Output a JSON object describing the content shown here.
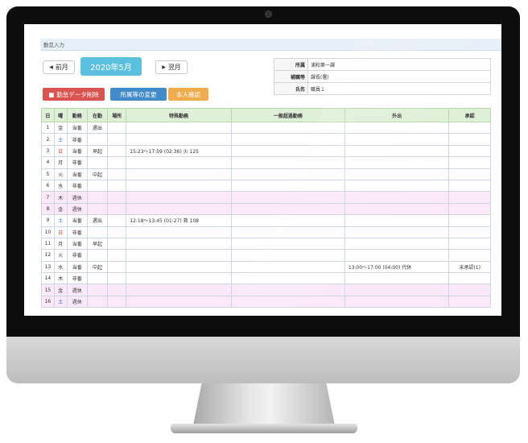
{
  "breadcrumb": "勤怠入力",
  "nav": {
    "prev_label": "前月",
    "month_label": "2020年5月",
    "next_label": "翌月"
  },
  "info": [
    {
      "key": "所属",
      "value": "浦和第一課"
    },
    {
      "key": "補職等",
      "value": "課長(署)"
    },
    {
      "key": "氏名",
      "value": "職員１"
    }
  ],
  "actions": {
    "delete_label": "勤怠データ削除",
    "change_label": "所属等の変更",
    "confirm_label": "本人確認"
  },
  "table": {
    "headers": [
      "日",
      "曜",
      "勤務",
      "在勤",
      "場所",
      "特殊勤務",
      "一般超過勤務",
      "外出",
      "承認"
    ],
    "rows": [
      {
        "day": "1",
        "dow": "金",
        "dow_type": "weekday",
        "shift": "当番",
        "zaikin": "遅出",
        "place": "",
        "special": "",
        "overtime": "",
        "outing": "",
        "approval": "",
        "holiday": false
      },
      {
        "day": "2",
        "dow": "土",
        "dow_type": "sat",
        "shift": "非番",
        "zaikin": "",
        "place": "",
        "special": "",
        "overtime": "",
        "outing": "",
        "approval": "",
        "holiday": false
      },
      {
        "day": "3",
        "dow": "日",
        "dow_type": "sun",
        "shift": "当番",
        "zaikin": "早起",
        "place": "",
        "special": "15:23～17:59 (02:36) 火 125",
        "overtime": "",
        "outing": "",
        "approval": "",
        "holiday": false
      },
      {
        "day": "4",
        "dow": "月",
        "dow_type": "weekday",
        "shift": "非番",
        "zaikin": "",
        "place": "",
        "special": "",
        "overtime": "",
        "outing": "",
        "approval": "",
        "holiday": false
      },
      {
        "day": "5",
        "dow": "火",
        "dow_type": "weekday",
        "shift": "当番",
        "zaikin": "中起",
        "place": "",
        "special": "",
        "overtime": "",
        "outing": "",
        "approval": "",
        "holiday": false
      },
      {
        "day": "6",
        "dow": "水",
        "dow_type": "weekday",
        "shift": "非番",
        "zaikin": "",
        "place": "",
        "special": "",
        "overtime": "",
        "outing": "",
        "approval": "",
        "holiday": false
      },
      {
        "day": "7",
        "dow": "木",
        "dow_type": "weekday",
        "shift": "週休",
        "zaikin": "",
        "place": "",
        "special": "",
        "overtime": "",
        "outing": "",
        "approval": "",
        "holiday": true
      },
      {
        "day": "8",
        "dow": "金",
        "dow_type": "weekday",
        "shift": "週休",
        "zaikin": "",
        "place": "",
        "special": "",
        "overtime": "",
        "outing": "",
        "approval": "",
        "holiday": true
      },
      {
        "day": "9",
        "dow": "土",
        "dow_type": "sat",
        "shift": "当番",
        "zaikin": "遅出",
        "place": "",
        "special": "12:18～13:45 (01:27) 救 108",
        "overtime": "",
        "outing": "",
        "approval": "",
        "holiday": false
      },
      {
        "day": "10",
        "dow": "日",
        "dow_type": "sun",
        "shift": "非番",
        "zaikin": "",
        "place": "",
        "special": "",
        "overtime": "",
        "outing": "",
        "approval": "",
        "holiday": false
      },
      {
        "day": "11",
        "dow": "月",
        "dow_type": "weekday",
        "shift": "当番",
        "zaikin": "早起",
        "place": "",
        "special": "",
        "overtime": "",
        "outing": "",
        "approval": "",
        "holiday": false
      },
      {
        "day": "12",
        "dow": "火",
        "dow_type": "weekday",
        "shift": "非番",
        "zaikin": "",
        "place": "",
        "special": "",
        "overtime": "",
        "outing": "",
        "approval": "",
        "holiday": false
      },
      {
        "day": "13",
        "dow": "水",
        "dow_type": "weekday",
        "shift": "当番",
        "zaikin": "中起",
        "place": "",
        "special": "",
        "overtime": "",
        "outing": "13:00～17:00 (04:00) 代休",
        "approval": "未承認(1)",
        "holiday": false
      },
      {
        "day": "14",
        "dow": "木",
        "dow_type": "weekday",
        "shift": "非番",
        "zaikin": "",
        "place": "",
        "special": "",
        "overtime": "",
        "outing": "",
        "approval": "",
        "holiday": false
      },
      {
        "day": "15",
        "dow": "金",
        "dow_type": "weekday",
        "shift": "週休",
        "zaikin": "",
        "place": "",
        "special": "",
        "overtime": "",
        "outing": "",
        "approval": "",
        "holiday": true
      },
      {
        "day": "16",
        "dow": "土",
        "dow_type": "sat",
        "shift": "週休",
        "zaikin": "",
        "place": "",
        "special": "",
        "overtime": "",
        "outing": "",
        "approval": "",
        "holiday": true
      }
    ]
  }
}
